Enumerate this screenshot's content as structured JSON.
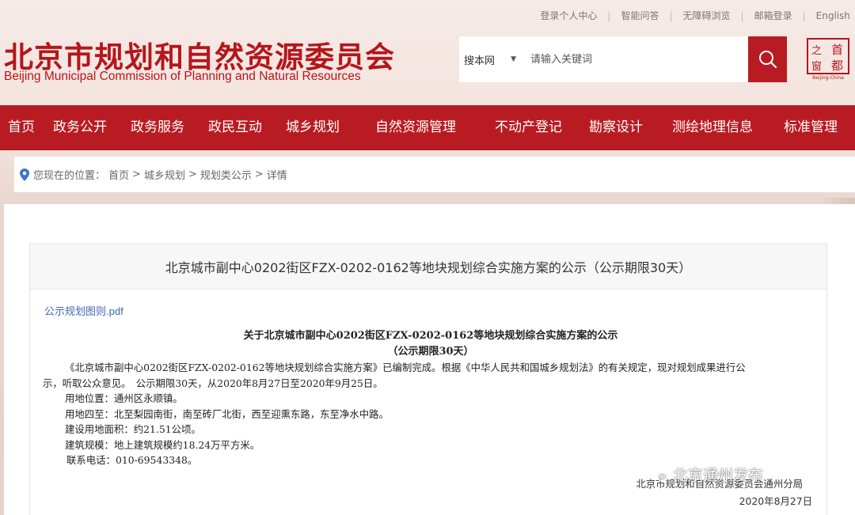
{
  "top_links": [
    "登录个人中心",
    "智能问答",
    "无障碍浏览",
    "邮箱登录",
    "English"
  ],
  "site": {
    "title": "北京市规划和自然资源委员会",
    "subtitle": "Beijing Municipal Commission of Planning and Natural Resources",
    "logo_chars": [
      "首",
      "都",
      "之",
      "窗"
    ],
    "logo_caption": "Beijing-China"
  },
  "search": {
    "scope": "搜本网",
    "placeholder": "请输入关键词"
  },
  "nav": [
    "首页",
    "政务公开",
    "政务服务",
    "政民互动",
    "城乡规划",
    "自然资源管理",
    "不动产登记",
    "勘察设计",
    "测绘地理信息",
    "标准管理"
  ],
  "breadcrumb": {
    "prefix": "您现在的位置：",
    "items": [
      "首页",
      "城乡规划",
      "规划类公示",
      "详情"
    ],
    "separator": ">"
  },
  "article": {
    "heading": "北京城市副中心0202街区FZX-0202-0162等地块规划综合实施方案的公示（公示期限30天）",
    "attachment": "公示规划图则.pdf",
    "doc_title": "关于北京城市副中心0202街区FZX-0202-0162等地块规划综合实施方案的公示",
    "doc_title_sub": "（公示期限30天）",
    "para1_line1": "《北京城市副中心0202街区FZX-0202-0162等地块规划综合实施方案》已编制完成。根据《中华人民共和国城乡规划法》的有关规定，现对规划成果进行公",
    "para1_line2": "示，听取公众意见。　公示期限30天，从2020年8月27日至2020年9月25日。",
    "location": "用地位置：通州区永顺镇。",
    "boundaries": "用地四至：北至梨园南街，南至砖厂北街，西至迎熏东路，东至净水中路。",
    "area": "建设用地面积：约21.51公顷。",
    "scale": "建筑规模：地上建筑规模约18.24万平方米。",
    "phone": "联系电话：010-69543348。",
    "signer": "北京市规划和自然资源委员会通州分局",
    "date": "2020年8月27日"
  },
  "watermark": "北京通州发布",
  "colors": {
    "brand_red": "#b81c22",
    "link_blue": "#3c6ab3"
  },
  "icons": [
    "search-icon",
    "location-pin-icon",
    "wechat-icon"
  ]
}
